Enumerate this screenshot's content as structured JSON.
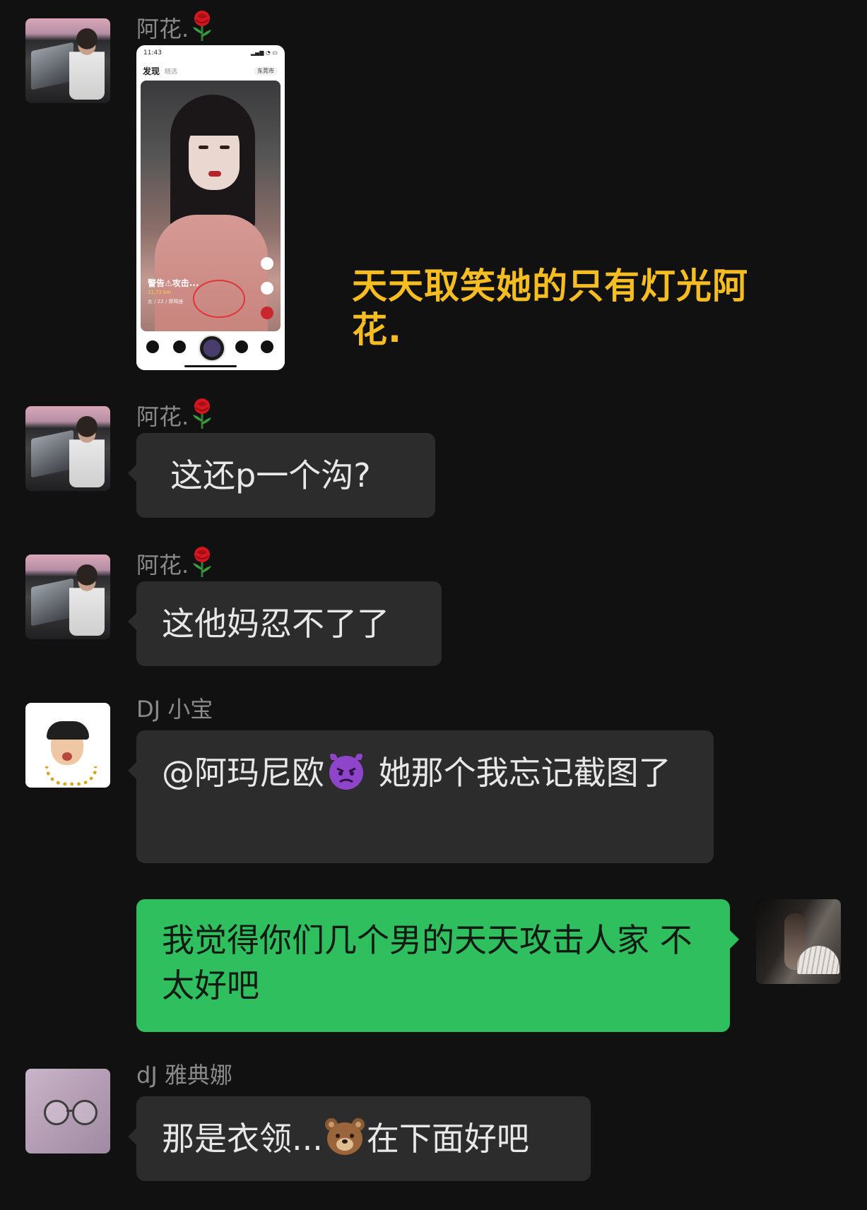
{
  "messages": [
    {
      "sender": "阿花.",
      "sender_emoji": "rose-icon",
      "type": "image",
      "screenshot": {
        "status_time": "11:43",
        "nav_title": "发现",
        "nav_sub": "精选",
        "nav_city": "东莞市",
        "caption": "警告⚠攻击...",
        "distance": "11.72 km",
        "meta": "女 / 22 / 摩羯座"
      },
      "overlay_text": "天天取笑她的只有灯光阿花."
    },
    {
      "sender": "阿花.",
      "sender_emoji": "rose-icon",
      "type": "text",
      "text": "这还p一个沟?"
    },
    {
      "sender": "阿花.",
      "sender_emoji": "rose-icon",
      "type": "text",
      "text": "这他妈忍不了了"
    },
    {
      "sender": "DJ 小宝",
      "type": "text",
      "text_part1": "@阿玛尼欧",
      "emoji": "devil-icon",
      "text_part2": " 她那个我忘记截图了"
    },
    {
      "sender": "me",
      "type": "text",
      "text": "我觉得你们几个男的天天攻击人家 不太好吧"
    },
    {
      "sender": "dJ 雅典娜",
      "type": "text",
      "text_part1": "那是衣领...",
      "emoji": "bear-icon",
      "text_part2": "在下面好吧"
    }
  ],
  "colors": {
    "background": "#111111",
    "bubble_other": "#2c2c2c",
    "bubble_me": "#2fbf5f",
    "name": "#8a8a8a",
    "overlay": "#f5bd1f"
  }
}
